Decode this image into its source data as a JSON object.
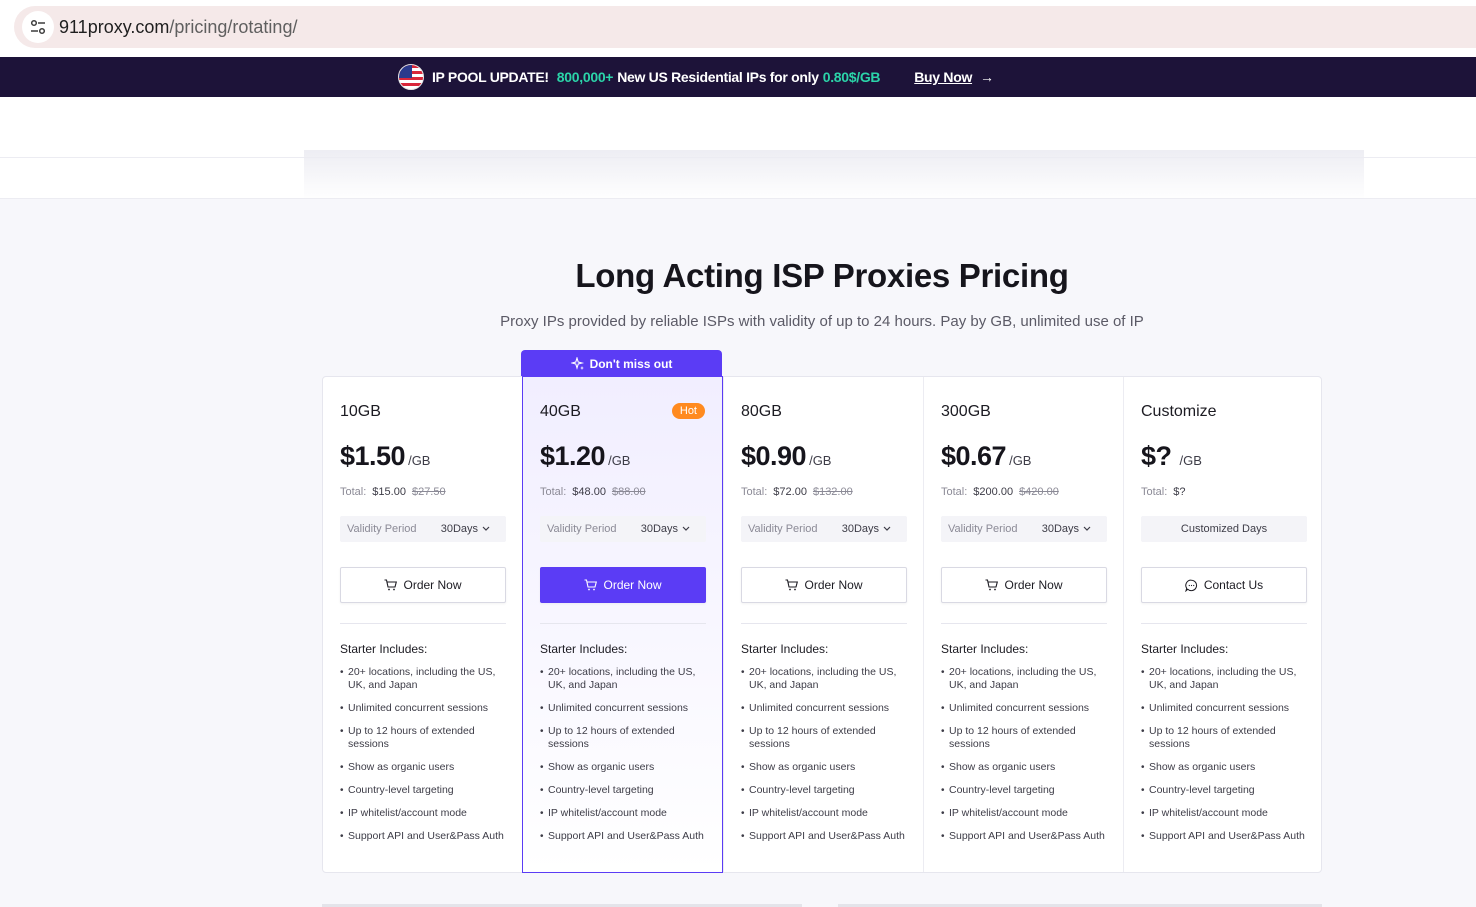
{
  "browser": {
    "url_host": "911proxy.com",
    "url_path": "/pricing/rotating/"
  },
  "promo": {
    "headline": "IP POOL UPDATE!",
    "count": "800,000+",
    "text": "New US Residential IPs for only",
    "price": "0.80$/GB",
    "cta": "Buy Now",
    "arrow": "→"
  },
  "page": {
    "title": "Long Acting ISP Proxies Pricing",
    "subtitle": "Proxy IPs provided by reliable ISPs with validity of up to 24 hours. Pay by GB, unlimited use of IP"
  },
  "ribbon_label": "Don't miss out",
  "plans": [
    {
      "name": "10GB",
      "price": "$1.50",
      "unit": "/GB",
      "total_label": "Total:",
      "total": "$15.00",
      "old_total": "$27.50",
      "validity_label": "Validity Period",
      "validity_value": "30Days",
      "button": "Order Now"
    },
    {
      "name": "40GB",
      "badge": "Hot",
      "price": "$1.20",
      "unit": "/GB",
      "total_label": "Total:",
      "total": "$48.00",
      "old_total": "$88.00",
      "validity_label": "Validity Period",
      "validity_value": "30Days",
      "button": "Order Now"
    },
    {
      "name": "80GB",
      "price": "$0.90",
      "unit": "/GB",
      "total_label": "Total:",
      "total": "$72.00",
      "old_total": "$132.00",
      "validity_label": "Validity Period",
      "validity_value": "30Days",
      "button": "Order Now"
    },
    {
      "name": "300GB",
      "price": "$0.67",
      "unit": "/GB",
      "total_label": "Total:",
      "total": "$200.00",
      "old_total": "$420.00",
      "validity_label": "Validity Period",
      "validity_value": "30Days",
      "button": "Order Now"
    },
    {
      "name": "Customize",
      "price": "$?",
      "unit": "/GB",
      "total_label": "Total:",
      "total": "$?",
      "validity_value": "Customized Days",
      "button": "Contact Us"
    }
  ],
  "includes_title": "Starter Includes:",
  "features": [
    "20+ locations, including the US, UK, and Japan",
    "Unlimited concurrent sessions",
    "Up to 12 hours of extended sessions",
    "Show as organic users",
    "Country-level targeting",
    "IP whitelist/account mode",
    "Support API and User&Pass Auth"
  ],
  "colors": {
    "accent": "#5b3cf5",
    "banner_bg": "#1d1339",
    "banner_highlight": "#2bd4a9",
    "hot_badge": "#ff8a1f"
  }
}
